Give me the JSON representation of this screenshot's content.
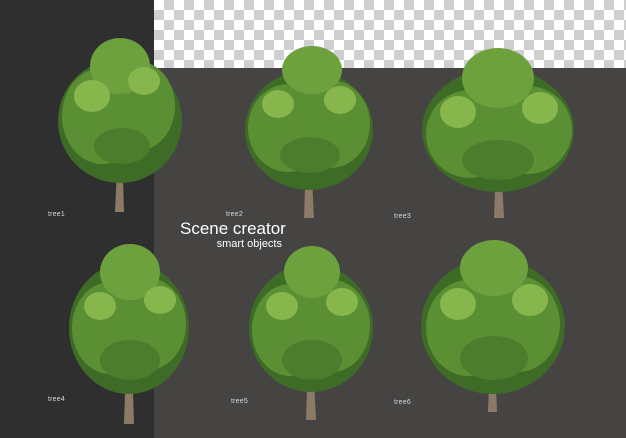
{
  "title": {
    "main": "Scene creator",
    "sub": "smart objects"
  },
  "colors": {
    "stage": "#454443",
    "left_panel": "#2f2f2f",
    "foliage_dark": "#3e6b25",
    "foliage_mid": "#5b8f33",
    "foliage_light": "#86b64c",
    "trunk": "#8a7a66"
  },
  "trees": [
    {
      "label": "tree1"
    },
    {
      "label": "tree2"
    },
    {
      "label": "tree3"
    },
    {
      "label": "tree4"
    },
    {
      "label": "tree5"
    },
    {
      "label": "tree6"
    }
  ]
}
